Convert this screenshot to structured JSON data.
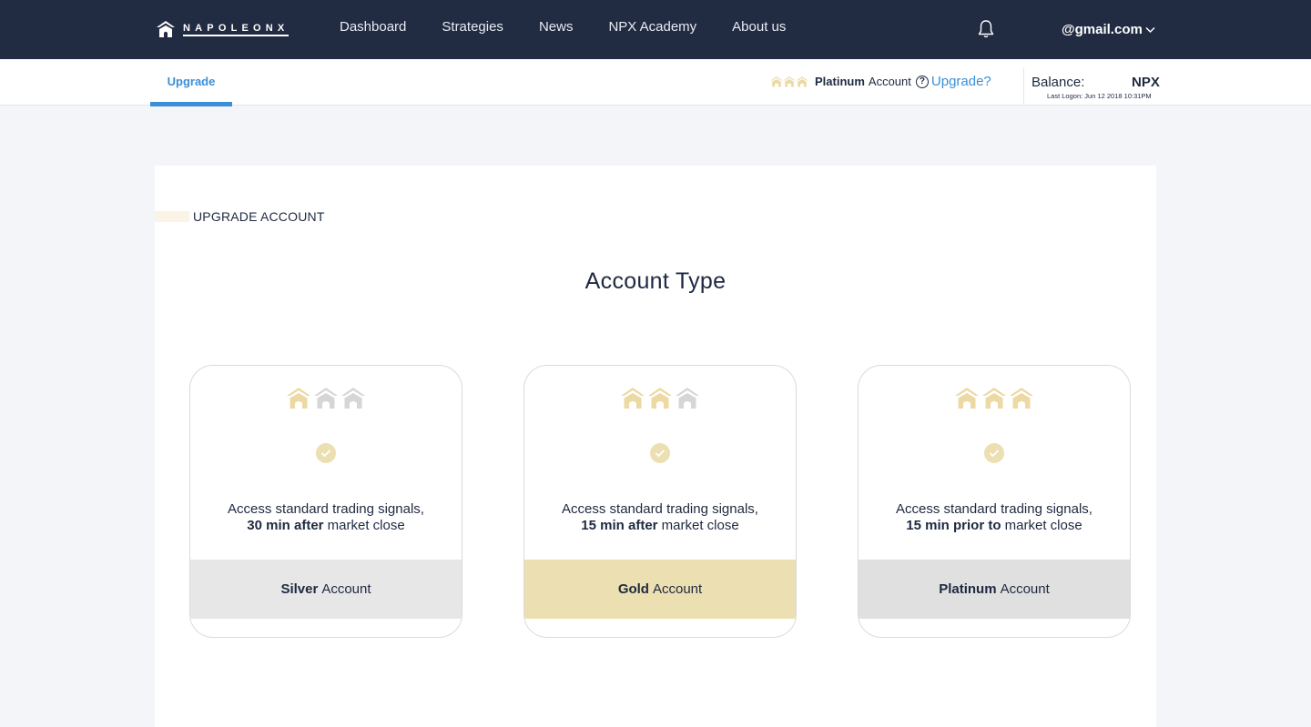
{
  "brand": {
    "name": "NAPOLEONX"
  },
  "nav": {
    "items": [
      {
        "label": "Dashboard"
      },
      {
        "label": "Strategies"
      },
      {
        "label": "News"
      },
      {
        "label": "NPX Academy"
      },
      {
        "label": "About us"
      }
    ],
    "user_email": "@gmail.com"
  },
  "subbar": {
    "tab_label": "Upgrade",
    "account_level": "Platinum",
    "account_word": "Account",
    "help_glyph": "?",
    "upgrade_link": "Upgrade?",
    "balance_label": "Balance:",
    "balance_unit": "NPX",
    "last_logon": "Last Logon: Jun 12 2018 10:31PM"
  },
  "main": {
    "section_title": "UPGRADE ACCOUNT",
    "page_title": "Account Type",
    "cards": [
      {
        "line1": "Access standard trading signals,",
        "emph": "30 min after",
        "rest": " market close",
        "tier": "Silver",
        "tier_word": "Account",
        "crowns_filled": 1
      },
      {
        "line1": "Access standard trading signals,",
        "emph": "15 min after",
        "rest": " market close",
        "tier": "Gold",
        "tier_word": "Account",
        "crowns_filled": 2
      },
      {
        "line1": "Access standard trading signals,",
        "emph": "15 min prior to",
        "rest": " market close",
        "tier": "Platinum",
        "tier_word": "Account",
        "crowns_filled": 3
      }
    ]
  },
  "colors": {
    "nav_bg": "#212b42",
    "accent": "#3a8fd6",
    "gold": "#ecdfb1",
    "silver": "#e7e7e7",
    "platinum": "#e0e0e0",
    "crown_filled": "#ecd9a3",
    "crown_empty": "#d6d6d6"
  }
}
